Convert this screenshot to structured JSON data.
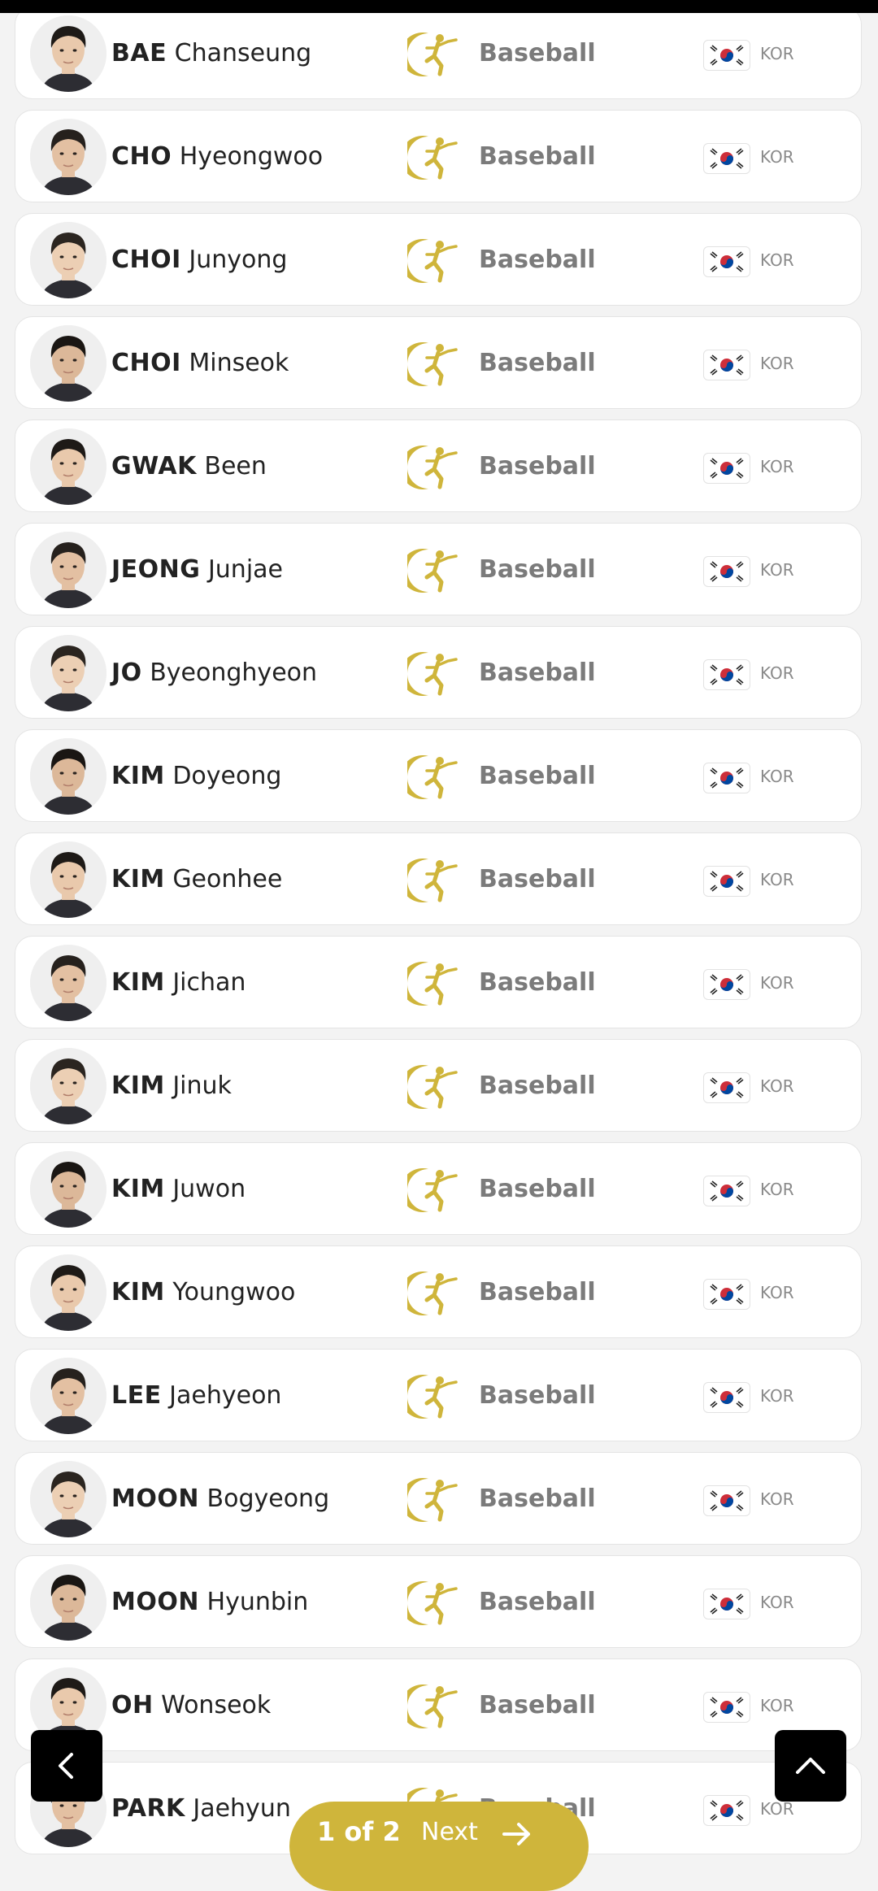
{
  "athletes": [
    {
      "last": "BAE",
      "first": "Chanseung",
      "sport": "Baseball",
      "noc": "KOR"
    },
    {
      "last": "CHO",
      "first": "Hyeongwoo",
      "sport": "Baseball",
      "noc": "KOR"
    },
    {
      "last": "CHOI",
      "first": "Junyong",
      "sport": "Baseball",
      "noc": "KOR"
    },
    {
      "last": "CHOI",
      "first": "Minseok",
      "sport": "Baseball",
      "noc": "KOR"
    },
    {
      "last": "GWAK",
      "first": "Been",
      "sport": "Baseball",
      "noc": "KOR"
    },
    {
      "last": "JEONG",
      "first": "Junjae",
      "sport": "Baseball",
      "noc": "KOR"
    },
    {
      "last": "JO",
      "first": "Byeonghyeon",
      "sport": "Baseball",
      "noc": "KOR"
    },
    {
      "last": "KIM",
      "first": "Doyeong",
      "sport": "Baseball",
      "noc": "KOR"
    },
    {
      "last": "KIM",
      "first": "Geonhee",
      "sport": "Baseball",
      "noc": "KOR"
    },
    {
      "last": "KIM",
      "first": "Jichan",
      "sport": "Baseball",
      "noc": "KOR"
    },
    {
      "last": "KIM",
      "first": "Jinuk",
      "sport": "Baseball",
      "noc": "KOR"
    },
    {
      "last": "KIM",
      "first": "Juwon",
      "sport": "Baseball",
      "noc": "KOR"
    },
    {
      "last": "KIM",
      "first": "Youngwoo",
      "sport": "Baseball",
      "noc": "KOR"
    },
    {
      "last": "LEE",
      "first": "Jaehyeon",
      "sport": "Baseball",
      "noc": "KOR"
    },
    {
      "last": "MOON",
      "first": "Bogyeong",
      "sport": "Baseball",
      "noc": "KOR"
    },
    {
      "last": "MOON",
      "first": "Hyunbin",
      "sport": "Baseball",
      "noc": "KOR"
    },
    {
      "last": "OH",
      "first": "Wonseok",
      "sport": "Baseball",
      "noc": "KOR"
    },
    {
      "last": "PARK",
      "first": "Jaehyun",
      "sport": "Baseball",
      "noc": "KOR"
    }
  ],
  "pagination": {
    "page_label": "1 of 2",
    "next_label": "Next"
  },
  "icons": {
    "sport": "baseball-pictogram-icon",
    "flag": "south-korea-flag-icon",
    "prev": "chevron-left-icon",
    "top": "chevron-up-icon",
    "next": "arrow-right-icon"
  },
  "colors": {
    "accent": "#cfb53b",
    "card_bg": "#ffffff",
    "page_bg": "#f3f3f3",
    "muted_text": "#7b7b7b"
  }
}
